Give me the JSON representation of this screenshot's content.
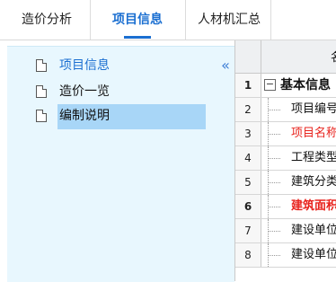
{
  "tabs": [
    {
      "label": "造价分析",
      "active": false
    },
    {
      "label": "项目信息",
      "active": true
    },
    {
      "label": "人材机汇总",
      "active": false
    }
  ],
  "colors": {
    "accent": "#1b6fd1",
    "selected_bg": "#a8d6f7",
    "panel_bg": "#e8f7fe",
    "required_red": "#e8231d"
  },
  "left_nav": {
    "collapse_icon": "double-chevron-left-icon",
    "items": [
      {
        "label": "项目信息",
        "icon": "document-icon",
        "state": "active"
      },
      {
        "label": "造价一览",
        "icon": "document-icon",
        "state": "normal"
      },
      {
        "label": "编制说明",
        "icon": "document-icon",
        "state": "selected"
      }
    ]
  },
  "grid": {
    "header_name": "名",
    "rows": [
      {
        "num": "1",
        "text": "基本信息",
        "type": "group",
        "expander": "−"
      },
      {
        "num": "2",
        "text": "项目编号",
        "type": "child"
      },
      {
        "num": "3",
        "text": "项目名称",
        "type": "child",
        "style": "red"
      },
      {
        "num": "4",
        "text": "工程类型",
        "type": "child"
      },
      {
        "num": "5",
        "text": "建筑分类",
        "type": "child"
      },
      {
        "num": "6",
        "text": "建筑面积",
        "type": "child",
        "style": "red-bold"
      },
      {
        "num": "7",
        "text": "建设单位",
        "type": "child"
      },
      {
        "num": "8",
        "text": "建设单位",
        "type": "child"
      }
    ]
  }
}
